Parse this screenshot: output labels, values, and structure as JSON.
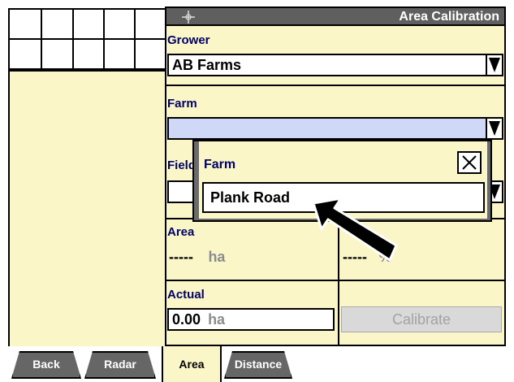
{
  "title": "Area Calibration",
  "grower": {
    "label": "Grower",
    "value": "AB Farms"
  },
  "farm": {
    "label": "Farm",
    "value": ""
  },
  "field": {
    "label": "Field"
  },
  "area": {
    "label": "Area",
    "value": "-----",
    "unit": "ha"
  },
  "percent": {
    "value": "-----",
    "unit": "%"
  },
  "actual": {
    "label": "Actual",
    "value": "0.00",
    "unit": "ha"
  },
  "calibrate_label": "Calibrate",
  "popup": {
    "title": "Farm",
    "option": "Plank Road",
    "close_icon": "close-icon"
  },
  "tabs": [
    {
      "label": "Back"
    },
    {
      "label": "Radar"
    },
    {
      "label": "Area",
      "active": true
    },
    {
      "label": "Distance"
    }
  ],
  "colors": {
    "panel": "#fbf6c8",
    "title_bar": "#5f5f5f",
    "label": "#000066",
    "tab": "#666666"
  }
}
